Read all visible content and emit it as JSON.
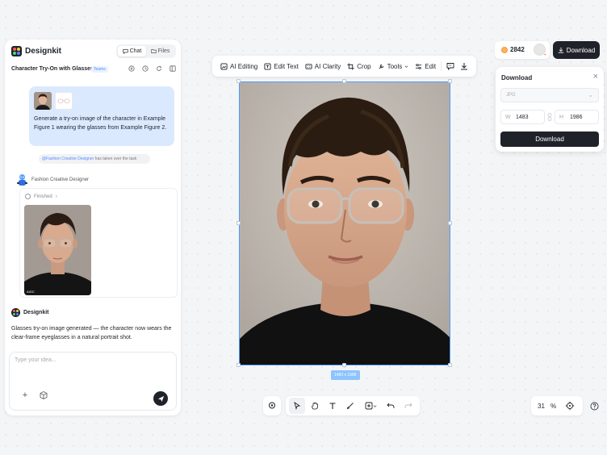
{
  "app": {
    "brand": "Designkit",
    "tabs": [
      {
        "label": "Chat"
      },
      {
        "label": "Files"
      }
    ]
  },
  "conversation": {
    "title": "Character Try-On with Glasses",
    "badge": "Teams",
    "user_message": "Generate a try-on image of the character in Example Figure 1 wearing the glasses from Example Figure 2.",
    "takeover_agent": "@Fashion Creative Designer",
    "takeover_text": " has taken over the task",
    "agent_name": "Fashion Creative Designer",
    "task_status": "Finished",
    "result_tag": "AIGC",
    "reply_author": "Designkit",
    "reply_text": "Glasses try-on image generated — the character now wears the clear-frame eyeglasses in a natural portrait shot.",
    "input_placeholder": "Type your idea..."
  },
  "toolbar": {
    "items": [
      {
        "label": "AI Editing",
        "icon": "ai-editing-icon"
      },
      {
        "label": "Edit Text",
        "icon": "edit-text-icon"
      },
      {
        "label": "AI Clarity",
        "icon": "ai-clarity-icon"
      },
      {
        "label": "Crop",
        "icon": "crop-icon"
      },
      {
        "label": "Tools",
        "icon": "tools-icon"
      },
      {
        "label": "Edit",
        "icon": "edit-sliders-icon"
      }
    ]
  },
  "canvas": {
    "size_label": "1483 x 1986"
  },
  "topbar": {
    "credits": "2842",
    "download_label": "Download"
  },
  "download_panel": {
    "title": "Download",
    "format": "JPG",
    "width_label": "W",
    "width": "1483",
    "height_label": "H",
    "height": "1986",
    "button": "Download"
  },
  "zoom": {
    "value": "31",
    "unit": "%"
  },
  "colors": {
    "accent": "#4f8bff",
    "dark": "#1f2329",
    "bubble": "#dbe9ff"
  }
}
